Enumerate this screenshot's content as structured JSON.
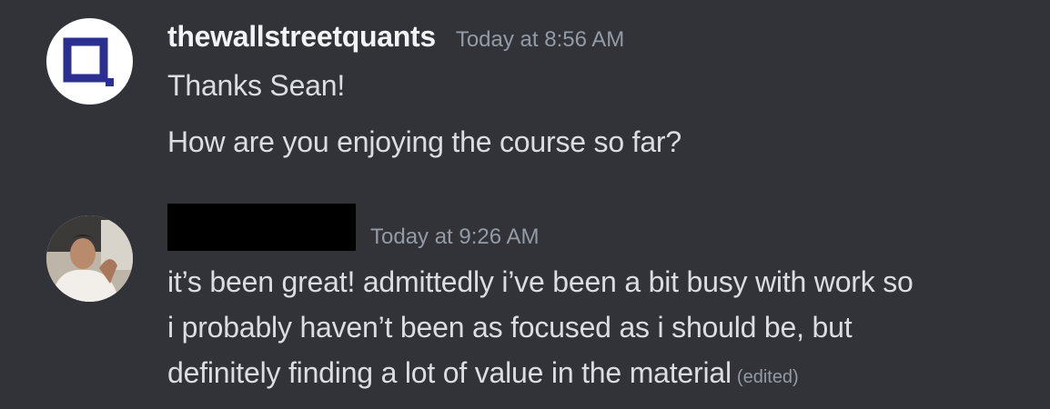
{
  "messages": [
    {
      "author": "thewallstreetquants",
      "timestamp": "Today at 8:56 AM",
      "avatar_icon": "square-logo-icon",
      "brand_color": "#2b2f8f",
      "lines": [
        "Thanks Sean!",
        "How are you enjoying the course so far?"
      ]
    },
    {
      "author_redacted": true,
      "timestamp": "Today at 9:26 AM",
      "avatar_icon": "user-photo-avatar",
      "lines": [
        "it’s been great! admittedly i’ve been a bit busy with work so",
        "i probably haven’t been as focused as i should be, but",
        "definitely finding a lot of value in the material"
      ],
      "edited_label": "(edited)"
    }
  ]
}
